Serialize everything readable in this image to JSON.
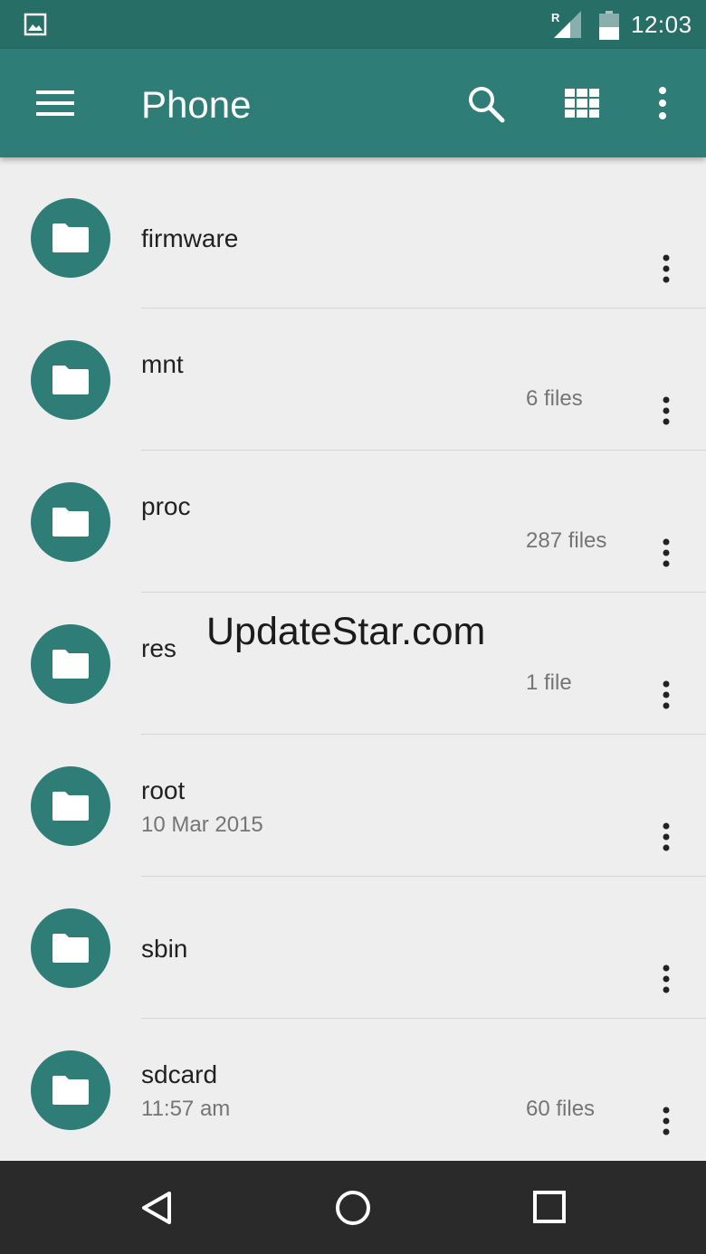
{
  "status_bar": {
    "time": "12:03",
    "roaming_indicator": "R",
    "icons": [
      "gallery-notification-icon",
      "signal-icon",
      "battery-icon"
    ]
  },
  "app_bar": {
    "title": "Phone",
    "icons": [
      "menu-icon",
      "search-icon",
      "grid-view-icon",
      "more-vert-icon"
    ]
  },
  "files": [
    {
      "name": "firmware",
      "date": "",
      "count": ""
    },
    {
      "name": "mnt",
      "date": "",
      "count": "6 files"
    },
    {
      "name": "proc",
      "date": "",
      "count": "287 files"
    },
    {
      "name": "res",
      "date": "",
      "count": "1 file"
    },
    {
      "name": "root",
      "date": "10 Mar 2015",
      "count": ""
    },
    {
      "name": "sbin",
      "date": "",
      "count": ""
    },
    {
      "name": "sdcard",
      "date": "11:57 am",
      "count": "60 files"
    }
  ],
  "watermark": "UpdateStar.com",
  "nav_bar": {
    "icons": [
      "back-icon",
      "home-icon",
      "recents-icon"
    ]
  },
  "colors": {
    "status_bar": "#276e67",
    "app_bar": "#2e7d77",
    "folder_circle": "#2e7d77",
    "background": "#eeeeee",
    "nav_bar": "#2a2a2a"
  }
}
